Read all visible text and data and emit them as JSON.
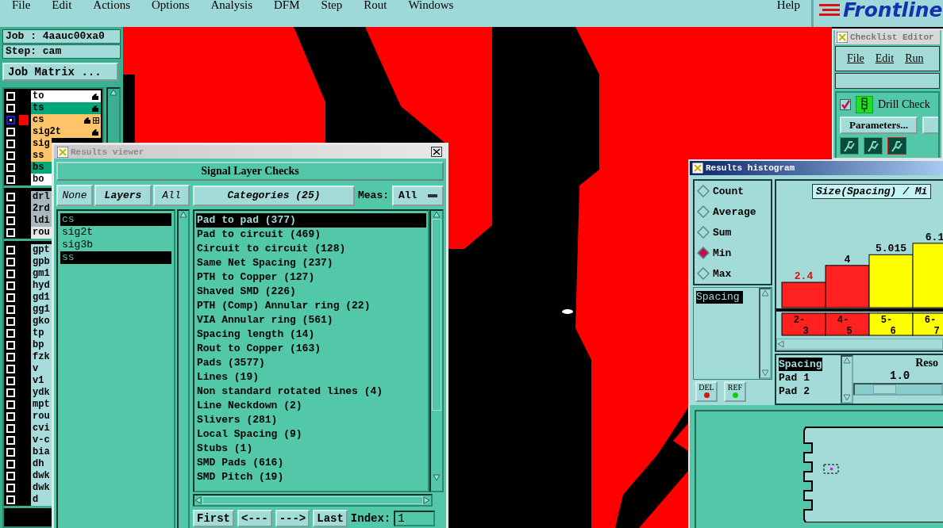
{
  "menu_bar": {
    "items": [
      "File",
      "Edit",
      "Actions",
      "Options",
      "Analysis",
      "DFM",
      "Step",
      "Rout",
      "Windows"
    ],
    "help": "Help"
  },
  "logo": {
    "text": "Frontline"
  },
  "job_panel": {
    "job": "Job : 4aauc00xa0",
    "step": "Step: cam",
    "matrix_button": "Job Matrix ..."
  },
  "layer_groups": [
    {
      "layers": [
        {
          "name": "to",
          "color": "#ffffff",
          "selected": false,
          "hand": true,
          "board": false
        },
        {
          "name": "ts",
          "color": "#00a77a",
          "selected": false,
          "hand": true,
          "board": false
        },
        {
          "name": "cs",
          "color": "#ffc36a",
          "selected": true,
          "hand": true,
          "board": true
        },
        {
          "name": "sig2t",
          "color": "#ffc36a",
          "selected": false,
          "hand": true,
          "board": false
        },
        {
          "name": "sig",
          "color": "#ffc36a",
          "selected": false,
          "hand": false,
          "board": false
        },
        {
          "name": "ss",
          "color": "#ffc36a",
          "selected": false,
          "hand": false,
          "board": false
        },
        {
          "name": "bs",
          "color": "#00a77a",
          "selected": false,
          "hand": false,
          "board": false
        },
        {
          "name": "bo",
          "color": "#ffffff",
          "selected": false,
          "hand": false,
          "board": false
        }
      ]
    },
    {
      "layers": [
        {
          "name": "drl",
          "color": "#a9b8bd",
          "selected": false,
          "hand": false,
          "board": false
        },
        {
          "name": "2rd",
          "color": "#a9b8bd",
          "selected": false,
          "hand": false,
          "board": false
        },
        {
          "name": "ldi",
          "color": "#a9b8bd",
          "selected": false,
          "hand": false,
          "board": false
        },
        {
          "name": "rou",
          "color": "#e8e8e8",
          "selected": false,
          "hand": false,
          "board": false
        }
      ]
    },
    {
      "layers": [
        {
          "name": "gpt",
          "color": "#a8dcdc",
          "selected": false,
          "hand": false,
          "board": false
        },
        {
          "name": "gpb",
          "color": "#a8dcdc",
          "selected": false,
          "hand": false,
          "board": false
        },
        {
          "name": "gm1",
          "color": "#a8dcdc",
          "selected": false,
          "hand": false,
          "board": false
        },
        {
          "name": "hyd",
          "color": "#a8dcdc",
          "selected": false,
          "hand": false,
          "board": false
        },
        {
          "name": "gd1",
          "color": "#a8dcdc",
          "selected": false,
          "hand": false,
          "board": false
        },
        {
          "name": "gg1",
          "color": "#a8dcdc",
          "selected": false,
          "hand": false,
          "board": false
        },
        {
          "name": "gko",
          "color": "#a8dcdc",
          "selected": false,
          "hand": false,
          "board": false
        },
        {
          "name": "tp",
          "color": "#a8dcdc",
          "selected": false,
          "hand": false,
          "board": false
        },
        {
          "name": "bp",
          "color": "#a8dcdc",
          "selected": false,
          "hand": false,
          "board": false
        },
        {
          "name": "fzk",
          "color": "#a8dcdc",
          "selected": false,
          "hand": false,
          "board": false
        },
        {
          "name": "v",
          "color": "#a8dcdc",
          "selected": false,
          "hand": false,
          "board": false
        },
        {
          "name": "v1",
          "color": "#a8dcdc",
          "selected": false,
          "hand": false,
          "board": false
        },
        {
          "name": "ydk",
          "color": "#a8dcdc",
          "selected": false,
          "hand": false,
          "board": false
        },
        {
          "name": "mpt",
          "color": "#a8dcdc",
          "selected": false,
          "hand": false,
          "board": false
        },
        {
          "name": "rou",
          "color": "#a8dcdc",
          "selected": false,
          "hand": false,
          "board": false
        },
        {
          "name": "cvi",
          "color": "#a8dcdc",
          "selected": false,
          "hand": false,
          "board": false
        },
        {
          "name": "v-c",
          "color": "#a8dcdc",
          "selected": false,
          "hand": false,
          "board": false
        },
        {
          "name": "bia",
          "color": "#a8dcdc",
          "selected": false,
          "hand": false,
          "board": false
        },
        {
          "name": "dh",
          "color": "#a8dcdc",
          "selected": false,
          "hand": false,
          "board": false
        },
        {
          "name": "dwk",
          "color": "#a8dcdc",
          "selected": false,
          "hand": false,
          "board": false
        },
        {
          "name": "dwk",
          "color": "#a8dcdc",
          "selected": false,
          "hand": false,
          "board": false
        },
        {
          "name": "d",
          "color": "#a8dcdc",
          "selected": false,
          "hand": false,
          "board": false
        }
      ]
    }
  ],
  "results_viewer": {
    "title": "Results viewer",
    "header": "Signal Layer Checks",
    "layer_buttons": [
      "None",
      "Layers",
      "All"
    ],
    "layers": [
      {
        "name": "cs",
        "selected": true
      },
      {
        "name": "sig2t",
        "selected": false
      },
      {
        "name": "sig3b",
        "selected": false
      },
      {
        "name": "ss",
        "selected": true
      }
    ],
    "categories_button": "Categories (25)",
    "meas_label": "Meas:",
    "meas_value": "All",
    "categories": [
      {
        "name": "Pad to pad (377)",
        "selected": true
      },
      {
        "name": "Pad to circuit (469)",
        "selected": false
      },
      {
        "name": "Circuit to circuit (128)",
        "selected": false
      },
      {
        "name": "Same Net Spacing (237)",
        "selected": false
      },
      {
        "name": "PTH to Copper (127)",
        "selected": false
      },
      {
        "name": "Shaved SMD (226)",
        "selected": false
      },
      {
        "name": "PTH (Comp) Annular ring (22)",
        "selected": false
      },
      {
        "name": "VIA Annular ring (561)",
        "selected": false
      },
      {
        "name": "Spacing length (14)",
        "selected": false
      },
      {
        "name": "Rout to Copper (163)",
        "selected": false
      },
      {
        "name": "Pads (3577)",
        "selected": false
      },
      {
        "name": "Lines (19)",
        "selected": false
      },
      {
        "name": "Non standard rotated lines (4)",
        "selected": false
      },
      {
        "name": "Line Neckdown (2)",
        "selected": false
      },
      {
        "name": "Slivers (281)",
        "selected": false
      },
      {
        "name": "Local Spacing (9)",
        "selected": false
      },
      {
        "name": "Stubs (1)",
        "selected": false
      },
      {
        "name": "SMD Pads (616)",
        "selected": false
      },
      {
        "name": "SMD Pitch (19)",
        "selected": false
      }
    ],
    "nav_buttons": [
      "First",
      "<---",
      "--->",
      "Last"
    ],
    "index_label": "Index:",
    "index_value": "1"
  },
  "histogram": {
    "title": "Results histogram",
    "modes": [
      {
        "label": "Count",
        "selected": false
      },
      {
        "label": "Average",
        "selected": false
      },
      {
        "label": "Sum",
        "selected": false
      },
      {
        "label": "Min",
        "selected": true
      },
      {
        "label": "Max",
        "selected": false
      }
    ],
    "measures": [
      {
        "name": "Spacing",
        "selected": true
      }
    ],
    "del_button": "DEL",
    "ref_button": "REF",
    "chart_title": "Size(Spacing) / Mi",
    "chart_data": {
      "type": "bar",
      "categories": [
        "2-3",
        "4-5",
        "5-6",
        "6-7"
      ],
      "series": [
        {
          "values": [
            2.4,
            4,
            5.015,
            6.1
          ]
        }
      ],
      "data_labels": true
    },
    "bins": [
      {
        "color": "#ff2020",
        "selected": true
      },
      {
        "color": "#ff2020",
        "selected": false
      },
      {
        "color": "#ffff00",
        "selected": false
      },
      {
        "color": "#ffff00",
        "selected": false
      }
    ],
    "fields": [
      {
        "name": "Spacing",
        "selected": true
      },
      {
        "name": "Pad 1",
        "selected": false
      },
      {
        "name": "Pad 2",
        "selected": false
      }
    ],
    "resolution_label": "Reso",
    "slider_value": "1.0",
    "slider": {
      "level": 0.27
    }
  },
  "checklist_editor": {
    "title": "Checklist Editor",
    "menu": [
      "File",
      "Edit",
      "Run"
    ],
    "check": {
      "name": "Drill Check",
      "checked": true
    },
    "parameters_button": "Parameters..."
  }
}
